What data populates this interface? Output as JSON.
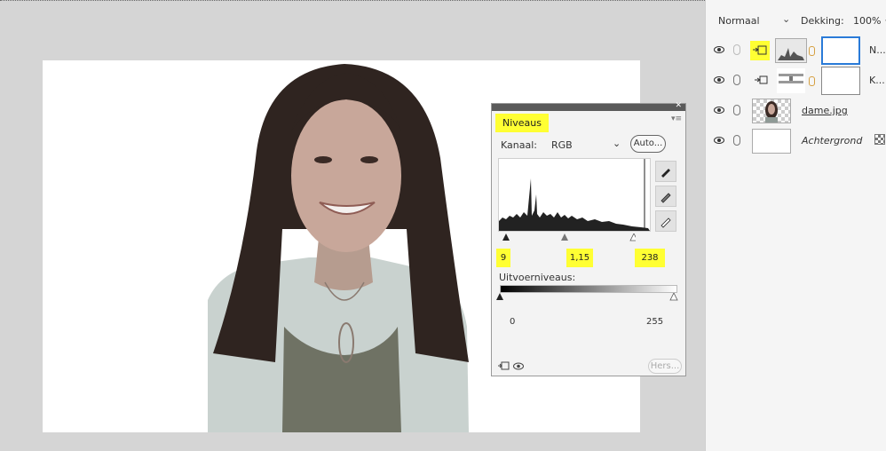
{
  "layers_panel": {
    "blend_mode": "Normaal",
    "opacity_label": "Dekking:",
    "opacity_value": "100%",
    "layers": [
      {
        "name": "N...",
        "type": "levels-adjustment",
        "selected": true
      },
      {
        "name": "K...",
        "type": "curves-adjustment",
        "selected": false
      },
      {
        "name": "dame.jpg",
        "type": "smart-object",
        "selected": false
      },
      {
        "name": "Achtergrond",
        "type": "background",
        "selected": false
      }
    ]
  },
  "properties": {
    "tab_label": "Niveaus",
    "channel_label": "Kanaal:",
    "channel_value": "RGB",
    "auto_label": "Auto...",
    "input_black": "9",
    "input_gamma": "1,15",
    "input_white": "238",
    "output_label": "Uitvoerniveaus:",
    "output_black": "0",
    "output_white": "255",
    "reset_label": "Hers..."
  },
  "colors": {
    "highlight": "#ffff33",
    "selection": "#2a7bd8"
  }
}
